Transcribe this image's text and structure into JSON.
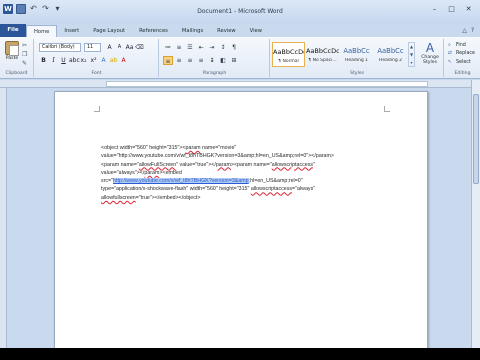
{
  "window": {
    "title": "Document1 - Microsoft Word",
    "controls": {
      "minimize": "–",
      "maximize": "□",
      "close": "✕"
    }
  },
  "quick_access": {
    "app_icon": "W",
    "icons": [
      "word-logo-icon",
      "save-icon",
      "undo-icon",
      "redo-icon",
      "customize-qat-icon"
    ]
  },
  "tabs": {
    "file": "File",
    "items": [
      "Home",
      "Insert",
      "Page Layout",
      "References",
      "Mailings",
      "Review",
      "View"
    ],
    "active": "Home"
  },
  "ribbon": {
    "clipboard": {
      "label": "Clipboard",
      "paste": "Paste"
    },
    "font": {
      "label": "Font",
      "font_name": "Calibri (Body)",
      "font_size": "11"
    },
    "paragraph": {
      "label": "Paragraph"
    },
    "styles": {
      "label": "Styles",
      "items": [
        {
          "sample": "AaBbCcDc",
          "name": "¶ Normal",
          "selected": true
        },
        {
          "sample": "AaBbCcDc",
          "name": "¶ No Spaci..."
        },
        {
          "sample": "AaBbCc",
          "name": "Heading 1"
        },
        {
          "sample": "AaBbCc",
          "name": "Heading 2"
        }
      ],
      "change_styles": "Change Styles"
    },
    "editing": {
      "label": "Editing",
      "find": "Find",
      "replace": "Replace",
      "select": "Select"
    }
  },
  "document": {
    "lines": [
      [
        {
          "t": "<object width=\"560\" height=\"315\"><"
        },
        {
          "t": "param",
          "s": "sq"
        },
        {
          "t": " name=\"movie\""
        }
      ],
      [
        {
          "t": "value=\"http://www.youtube.com/v/wf_t8hTBHGK?version=3&amp;hl=en_US&amp;rel=0\"></param>"
        }
      ],
      [
        {
          "t": "<param name=\""
        },
        {
          "t": "allowFullScreen",
          "s": "sq"
        },
        {
          "t": "\" value=\"true\"></"
        },
        {
          "t": "param",
          "s": "sq"
        },
        {
          "t": "><param name=\""
        },
        {
          "t": "allowscriptaccess",
          "s": "sq"
        },
        {
          "t": "\""
        }
      ],
      [
        {
          "t": "value=\"always\"></"
        },
        {
          "t": "param",
          "s": "sq"
        },
        {
          "t": "><embed"
        }
      ],
      [
        {
          "t": "src=\""
        },
        {
          "t": "http://www.youtube.com/v/wf_t8hTBHGK?version=3&amp",
          "s": "link sel"
        },
        {
          "t": ";hl=en_US&amp;rel=0\""
        }
      ],
      [
        {
          "t": "type=\"application/x-shockwave-flash\" width=\"560\" height=\"315\" "
        },
        {
          "t": "allowscriptaccess",
          "s": "sq"
        },
        {
          "t": "=\"always\""
        }
      ],
      [
        {
          "t": "allowfullscreen",
          "s": "sq"
        },
        {
          "t": "=\"true\"></embed></object>"
        }
      ]
    ]
  }
}
